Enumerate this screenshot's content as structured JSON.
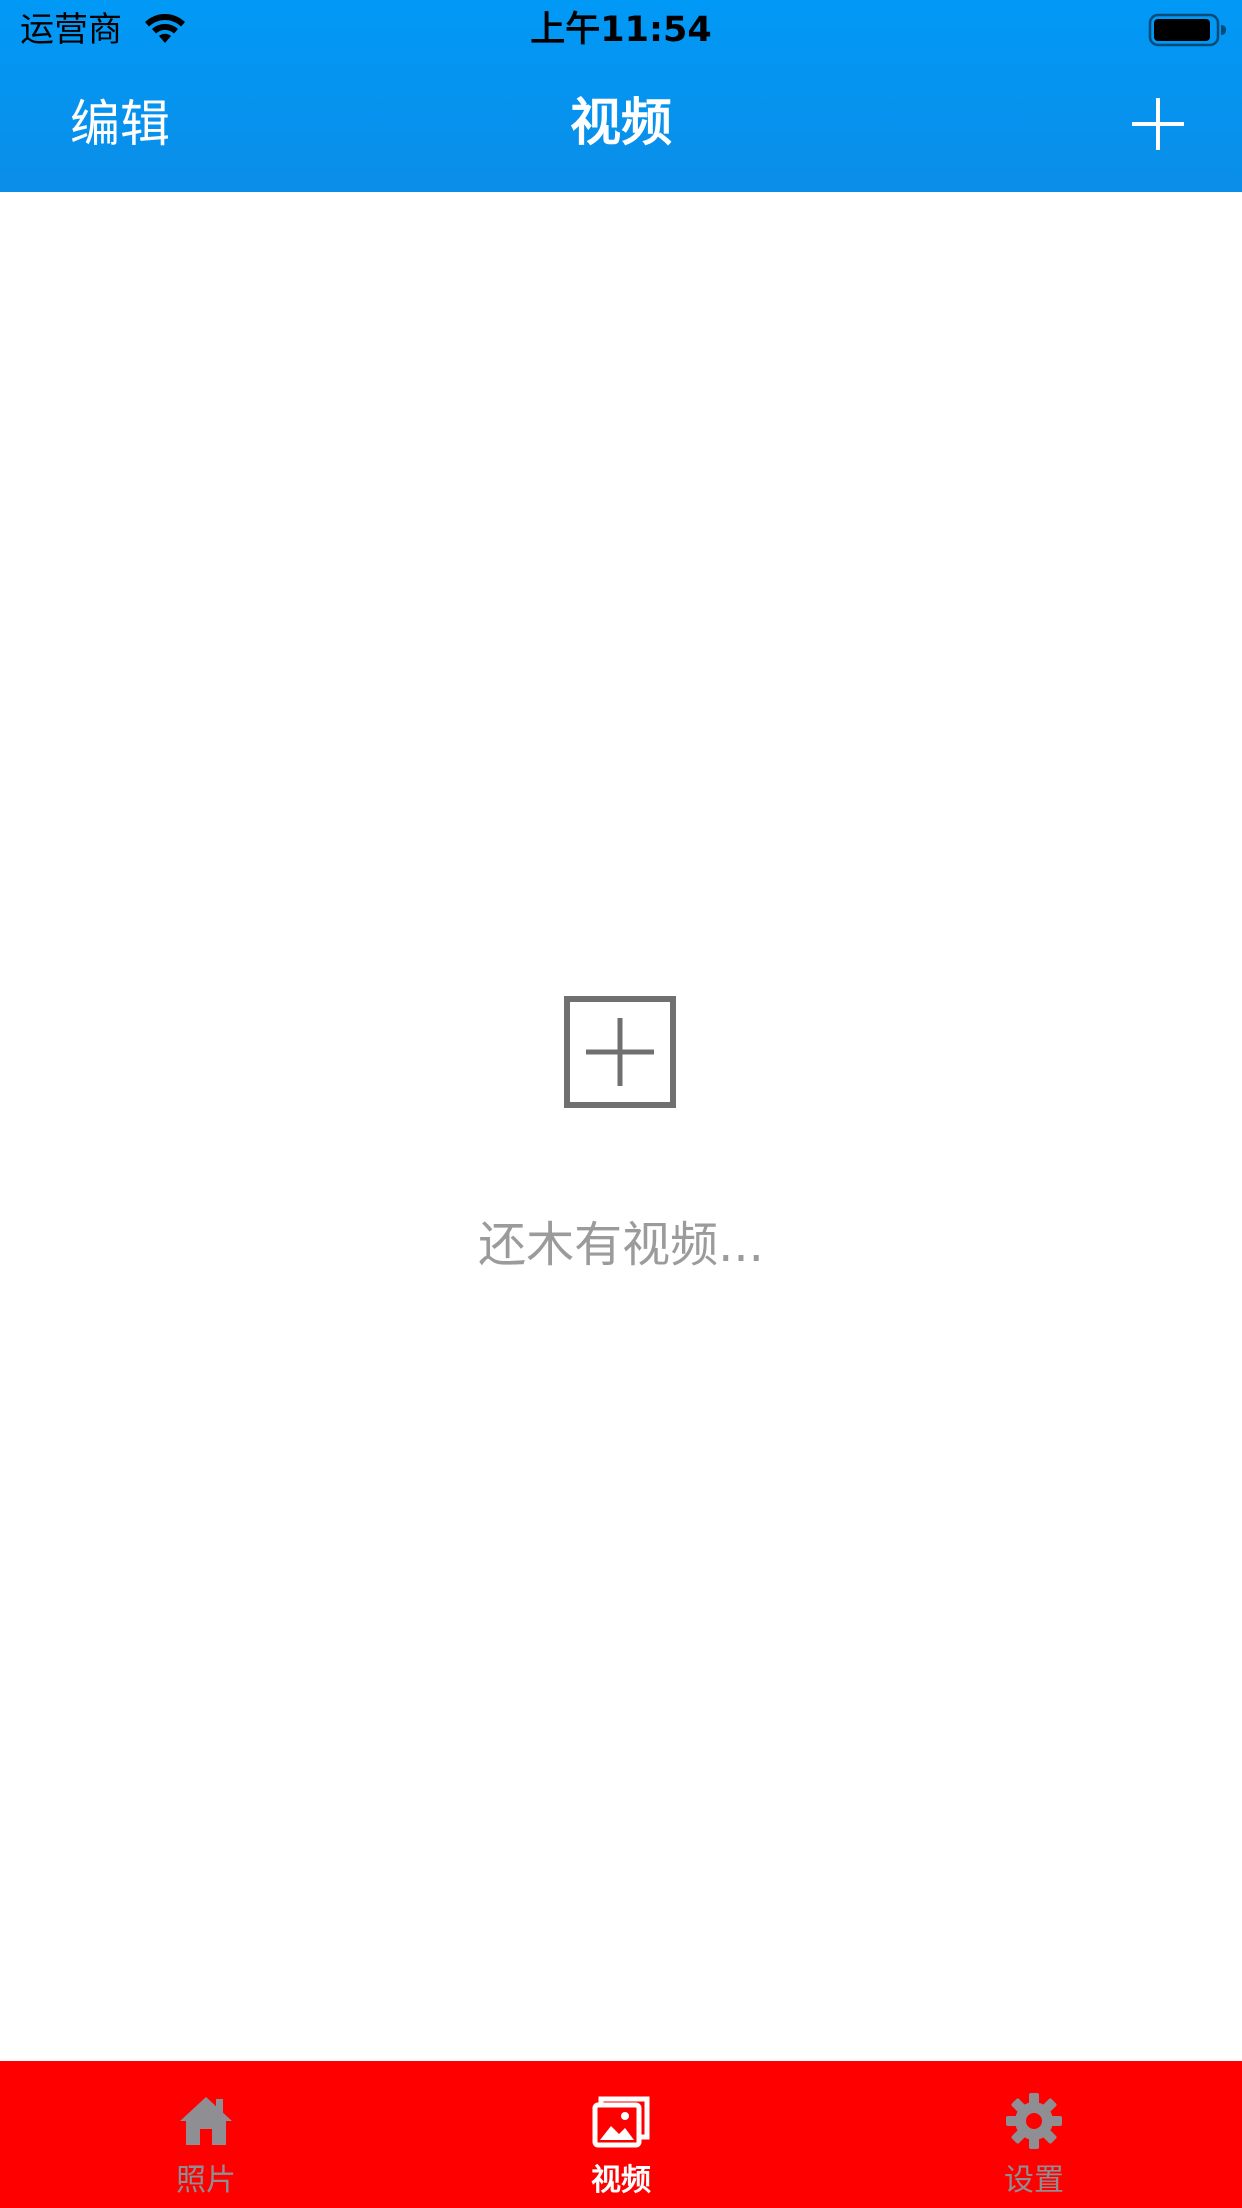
{
  "status_bar": {
    "carrier": "运营商",
    "time": "上午11:54",
    "wifi_icon": "wifi-icon",
    "battery_icon": "battery-icon"
  },
  "nav": {
    "edit_label": "编辑",
    "title": "视频",
    "add_icon": "plus-icon"
  },
  "empty_state": {
    "icon": "add-box-icon",
    "message": "还木有视频..."
  },
  "tabs": [
    {
      "label": "照片",
      "icon": "home-icon",
      "active": false
    },
    {
      "label": "视频",
      "icon": "image-icon",
      "active": true
    },
    {
      "label": "设置",
      "icon": "gear-icon",
      "active": false
    }
  ],
  "colors": {
    "nav_background": "#0199f6",
    "tab_bar_background": "#ff0000",
    "tab_inactive": "#8e8e93",
    "tab_active": "#ffffff",
    "empty_text": "#9b9b9b",
    "empty_icon": "#707070"
  }
}
